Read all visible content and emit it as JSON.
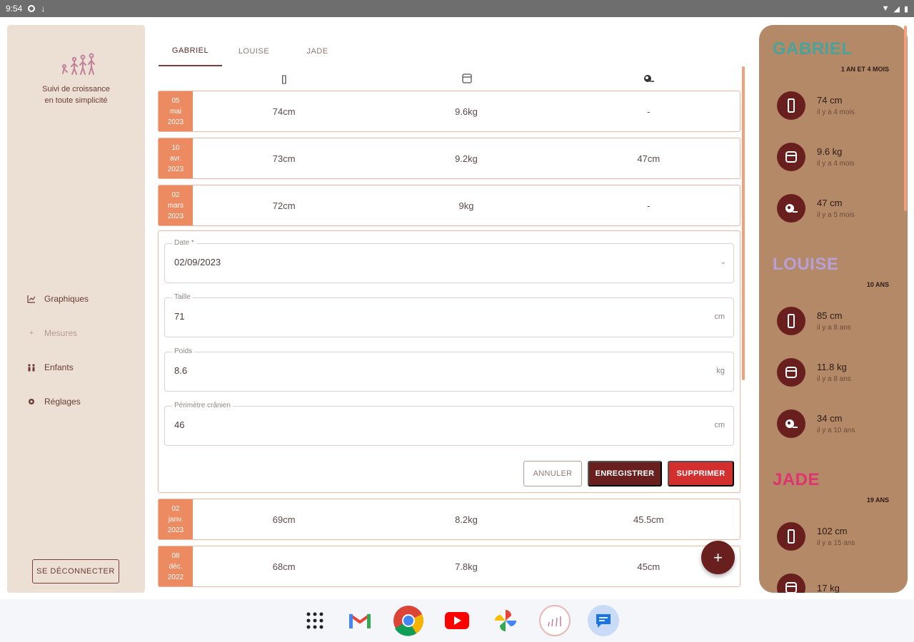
{
  "status_bar": {
    "time": "9:54"
  },
  "sidebar": {
    "tagline": [
      "Suivi de croissance",
      "en toute simplicité"
    ],
    "nav": [
      {
        "label": "Graphiques",
        "icon": "chart-icon"
      },
      {
        "label": "Mesures",
        "icon": "plus-icon"
      },
      {
        "label": "Enfants",
        "icon": "children-icon"
      },
      {
        "label": "Réglages",
        "icon": "gear-icon"
      }
    ],
    "logout": "SE DÉCONNECTER"
  },
  "tabs": [
    "GABRIEL",
    "LOUISE",
    "JADE"
  ],
  "columns": {
    "height_icon": "[]",
    "weight_icon": "scale-icon",
    "head_icon": "head-icon"
  },
  "rows": [
    {
      "day": "05",
      "month": "mai",
      "year": "2023",
      "taille": "74cm",
      "poids": "9.6kg",
      "perimetre": "-"
    },
    {
      "day": "10",
      "month": "avr.",
      "year": "2023",
      "taille": "73cm",
      "poids": "9.2kg",
      "perimetre": "47cm"
    },
    {
      "day": "02",
      "month": "mars",
      "year": "2023",
      "taille": "72cm",
      "poids": "9kg",
      "perimetre": "-"
    },
    {
      "day": "02",
      "month": "janv.",
      "year": "2023",
      "taille": "69cm",
      "poids": "8.2kg",
      "perimetre": "45.5cm"
    },
    {
      "day": "08",
      "month": "déc.",
      "year": "2022",
      "taille": "68cm",
      "poids": "7.8kg",
      "perimetre": "45cm"
    }
  ],
  "form": {
    "date": {
      "label": "Date *",
      "value": "02/09/2023"
    },
    "taille": {
      "label": "Taille",
      "value": "71",
      "unit": "cm"
    },
    "poids": {
      "label": "Poids",
      "value": "8.6",
      "unit": "kg"
    },
    "perimetre": {
      "label": "Périmètre crânien",
      "value": "46",
      "unit": "cm"
    },
    "cancel": "ANNULER",
    "save": "ENREGISTRER",
    "delete": "SUPPRIMER"
  },
  "fab": "+",
  "children": [
    {
      "name": "GABRIEL",
      "color": "#4aa39a",
      "age": "1 AN ET 4 MOIS",
      "stats": [
        {
          "icon": "ruler-icon",
          "value": "74 cm",
          "ago": "il y a 4 mois"
        },
        {
          "icon": "scale-icon",
          "value": "9.6 kg",
          "ago": "il y a 4 mois"
        },
        {
          "icon": "head-icon",
          "value": "47 cm",
          "ago": "il y a 5 mois"
        }
      ]
    },
    {
      "name": "LOUISE",
      "color": "#b7a0d6",
      "age": "10 ANS",
      "stats": [
        {
          "icon": "ruler-icon",
          "value": "85 cm",
          "ago": "il y a 8 ans"
        },
        {
          "icon": "scale-icon",
          "value": "11.8 kg",
          "ago": "il y a 8 ans"
        },
        {
          "icon": "head-icon",
          "value": "34 cm",
          "ago": "il y a 10 ans"
        }
      ]
    },
    {
      "name": "JADE",
      "color": "#e0336f",
      "age": "19 ANS",
      "stats": [
        {
          "icon": "ruler-icon",
          "value": "102 cm",
          "ago": "il y a 15 ans"
        },
        {
          "icon": "scale-icon",
          "value": "17 kg",
          "ago": ""
        }
      ]
    }
  ],
  "dock": [
    "apps-icon",
    "gmail-icon",
    "chrome-icon",
    "youtube-icon",
    "photos-icon",
    "growth-app-icon",
    "messages-icon"
  ]
}
